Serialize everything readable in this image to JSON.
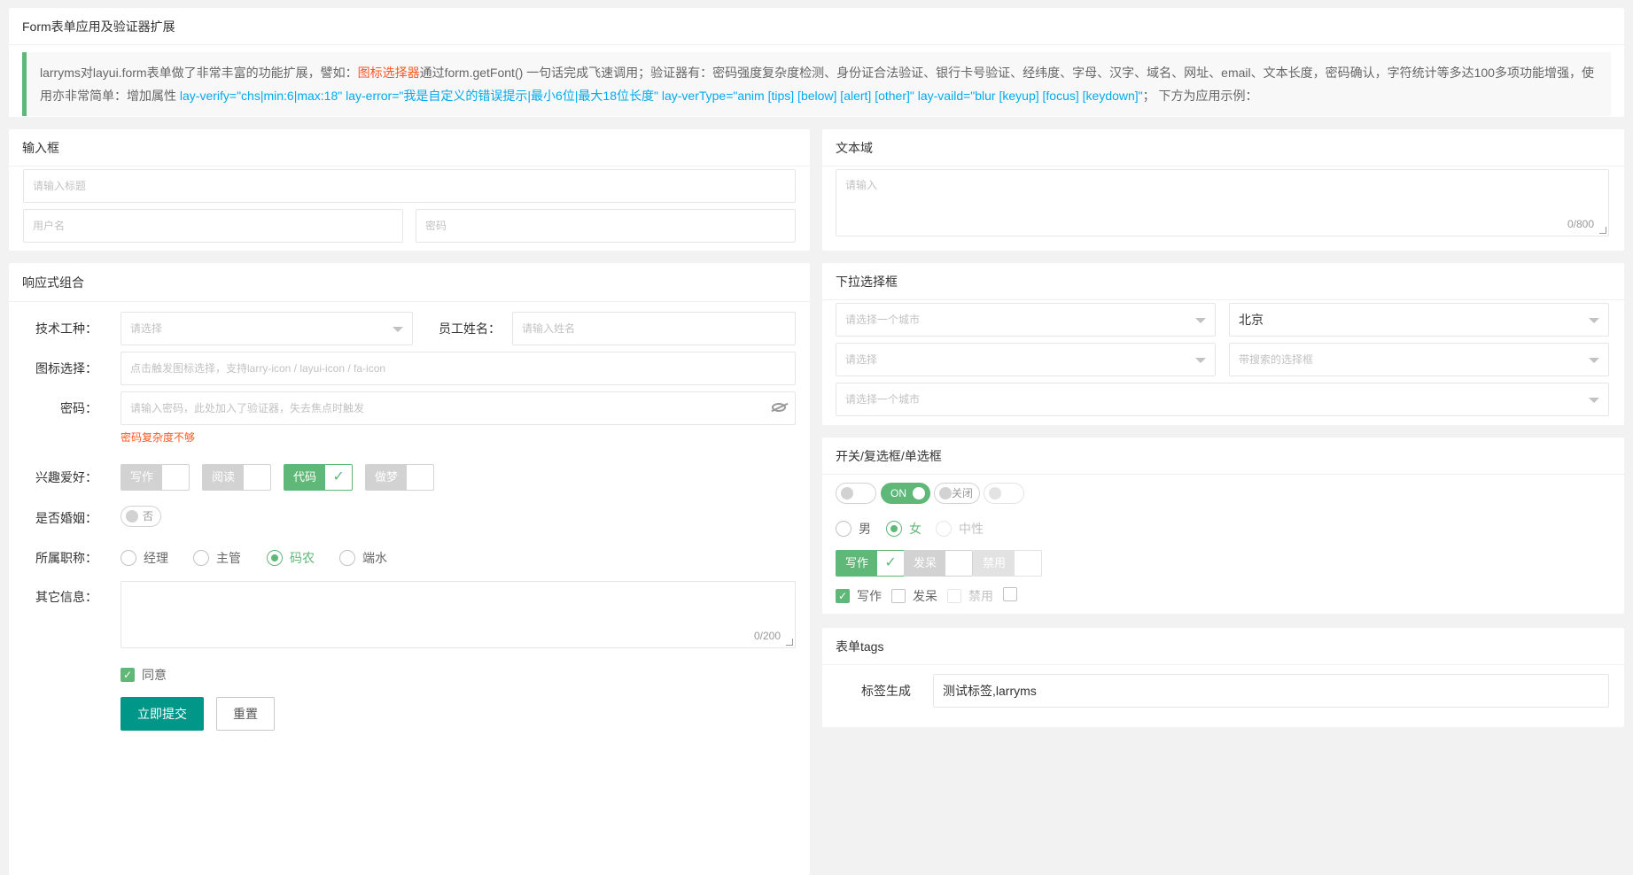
{
  "intro": {
    "title": "Form表单应用及验证器扩展",
    "p1": "larryms对layui.form表单做了非常丰富的功能扩展，譬如：",
    "p1_red": "图标选择器",
    "p1b": "通过form.getFont() 一句话完成飞速调用；验证器有：密码强度复杂度检测、身份证合法验证、银行卡号验证、经纬度、字母、汉字、域名、网址、email、文本长度，密码确认，字符统计等多达100多项功能增强，使用亦非常简单：增加属性 ",
    "p1_blue": "lay-verify=\"chs|min:6|max:18\" lay-error=\"我是自定义的错误提示|最小6位|最大18位长度\" lay-verType=\"anim [tips] [below] [alert] [other]\" lay-vaild=\"blur [keyup] [focus] [keydown]\"",
    "p1c": "；  下方为应用示例："
  },
  "input_card": {
    "title": "输入框",
    "title_placeholder": "请输入标题",
    "username_placeholder": "用户名",
    "password_placeholder": "密码"
  },
  "textarea_card": {
    "title": "文本域",
    "placeholder": "请输入",
    "counter": "0/800"
  },
  "combo_card": {
    "title": "响应式组合",
    "job_label": "技术工种：",
    "job_placeholder": "请选择",
    "name_label": "员工姓名：",
    "name_placeholder": "请输入姓名",
    "icon_label": "图标选择：",
    "icon_placeholder": "点击触发图标选择，支持larry-icon / layui-icon / fa-icon",
    "pwd_label": "密码：",
    "pwd_placeholder": "请输入密码，此处加入了验证器，失去焦点时触发",
    "pwd_error": "密码复杂度不够",
    "hobby_label": "兴趣爱好：",
    "hobbies": [
      "写作",
      "阅读",
      "代码",
      "做梦"
    ],
    "married_label": "是否婚姻：",
    "married_switch": "否",
    "role_label": "所属职称：",
    "roles": [
      "经理",
      "主管",
      "码农",
      "端水"
    ],
    "other_label": "其它信息：",
    "other_counter": "0/200",
    "agree": "同意",
    "submit": "立即提交",
    "reset": "重置"
  },
  "select_card": {
    "title": "下拉选择框",
    "s1": "请选择一个城市",
    "s2": "北京",
    "s3": "请选择",
    "s4": "带搜索的选择框",
    "s5": "请选择一个城市"
  },
  "switch_card": {
    "title": "开关/复选框/单选框",
    "sw_on": "ON",
    "sw_off": "关闭",
    "radios": [
      "男",
      "女",
      "中性"
    ],
    "cb_a": [
      "写作",
      "发呆",
      "禁用"
    ],
    "cb_b": [
      "写作",
      "发呆",
      "禁用"
    ]
  },
  "tags_card": {
    "title": "表单tags",
    "label": "标签生成",
    "value": "测试标签,larryms"
  },
  "colors": {
    "primary": "#009688",
    "green": "#5fb878",
    "error": "#ff5722",
    "link": "#01aaed"
  }
}
